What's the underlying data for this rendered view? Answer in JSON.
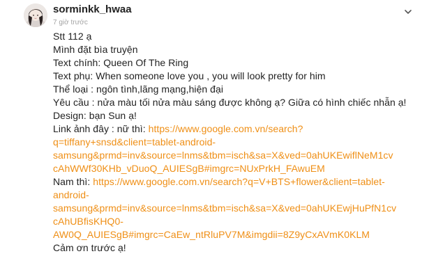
{
  "user": {
    "username": "sorminkk_hwaa",
    "timestamp": "7 giờ trước"
  },
  "menu": {
    "icon": "chevron-down-icon"
  },
  "post": {
    "line_stt": "Stt 112 ạ",
    "line_request": "Mình đặt bìa truyện",
    "line_main_text": "Text chính: Queen Of The Ring",
    "line_sub_text": "Text phụ: When someone love you , you will look pretty for him",
    "line_genre": "Thể loại : ngôn tình,lãng mạng,hiện đại",
    "line_demand": "Yêu cầu : nửa màu tối nửa màu sáng được không ạ?  Giữa có hình chiếc nhẫn ạ!",
    "line_design": "Design: bạn Sun ạ!",
    "female_label": "Link ảnh đây : nữ thì: ",
    "female_link_lines": [
      "https://www.google.com.vn/search?",
      "q=tiffany+snsd&client=tablet-android-",
      "samsung&prmd=inv&source=lnms&tbm=isch&sa=X&ved=0ahUKEwiflNeM1cv",
      "cAhWWf30KHb_vDuoQ_AUIESgB#imgrc=NUxPrkH_FAwuEM"
    ],
    "male_label": "Nam thì: ",
    "male_link_lines": [
      "https://www.google.com.vn/search?q=V+BTS+flower&client=tablet-",
      "android-",
      "samsung&prmd=inv&source=lnms&tbm=isch&sa=X&ved=0ahUKEwjHuPfN1cv",
      "cAhUBfisKHQ0-",
      "AW0Q_AUIESgB#imgrc=CaEw_ntRluPV7M&imgdii=8Z9yCxAVmK0KLM"
    ],
    "line_thanks": "Cảm ơn trước ạ!"
  },
  "colors": {
    "link": "#ef8f16",
    "text": "#222222",
    "muted": "#a3a3a3"
  }
}
